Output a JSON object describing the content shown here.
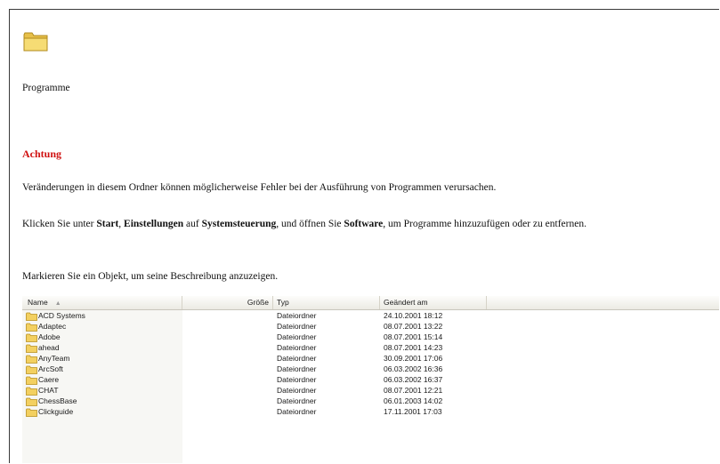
{
  "folder": {
    "name": "Programme",
    "icon": "folder-icon",
    "icon_color": "#f2d35a"
  },
  "warning": {
    "title": "Achtung",
    "title_color": "#d01010",
    "line1": "Veränderungen in diesem Ordner können möglicherweise Fehler bei der Ausführung von Programmen verursachen.",
    "line2_pre": "Klicken Sie unter ",
    "line2_start": "Start",
    "line2_sep1": ", ",
    "line2_settings": "Einstellungen",
    "line2_mid": " auf ",
    "line2_control": "Systemsteuerung",
    "line2_mid2": ", und öffnen Sie ",
    "line2_software": "Software",
    "line2_post": ", um Programme hinzuzufügen oder zu entfernen.",
    "line3": "Markieren Sie ein Objekt, um seine Beschreibung anzuzeigen."
  },
  "list": {
    "columns": {
      "name": "Name",
      "size": "Größe",
      "type": "Typ",
      "modified": "Geändert am"
    },
    "sort_icon": "sort-ascending-icon",
    "rows": [
      {
        "name": "ACD Systems",
        "type": "Dateiordner",
        "modified": "24.10.2001 18:12"
      },
      {
        "name": "Adaptec",
        "type": "Dateiordner",
        "modified": "08.07.2001 13:22"
      },
      {
        "name": "Adobe",
        "type": "Dateiordner",
        "modified": "08.07.2001 15:14"
      },
      {
        "name": "ahead",
        "type": "Dateiordner",
        "modified": "08.07.2001 14:23"
      },
      {
        "name": "AnyTeam",
        "type": "Dateiordner",
        "modified": "30.09.2001 17:06"
      },
      {
        "name": "ArcSoft",
        "type": "Dateiordner",
        "modified": "06.03.2002 16:36"
      },
      {
        "name": "Caere",
        "type": "Dateiordner",
        "modified": "06.03.2002 16:37"
      },
      {
        "name": "CHAT",
        "type": "Dateiordner",
        "modified": "08.07.2001 12:21"
      },
      {
        "name": "ChessBase",
        "type": "Dateiordner",
        "modified": "06.01.2003 14:02"
      },
      {
        "name": "Clickguide",
        "type": "Dateiordner",
        "modified": "17.11.2001 17:03"
      }
    ]
  }
}
